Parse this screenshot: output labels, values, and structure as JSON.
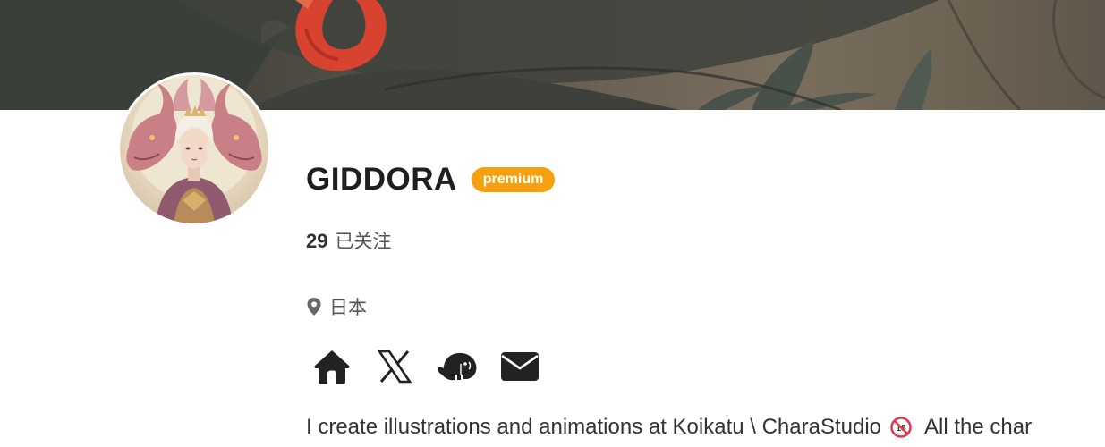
{
  "cover": {
    "icon": "cover-illustration"
  },
  "profile": {
    "avatar_icon": "dragon-avatar",
    "name": "GIDDORA",
    "badge": "premium",
    "following_count": "29",
    "following_label": "已关注",
    "location_icon": "map-pin-icon",
    "location": "日本",
    "bio_part1": "I create illustrations and animations at Koikatu \\ CharaStudio",
    "bio_emoji": "no-under-18-icon",
    "bio_part2": "All the char"
  },
  "socials": [
    {
      "name": "home-icon"
    },
    {
      "name": "x-icon"
    },
    {
      "name": "mastodon-icon"
    },
    {
      "name": "mail-icon"
    }
  ],
  "colors": {
    "badge": "#f5a10f",
    "text": "#333333",
    "name": "#1f1f1f",
    "muted": "#555555"
  }
}
